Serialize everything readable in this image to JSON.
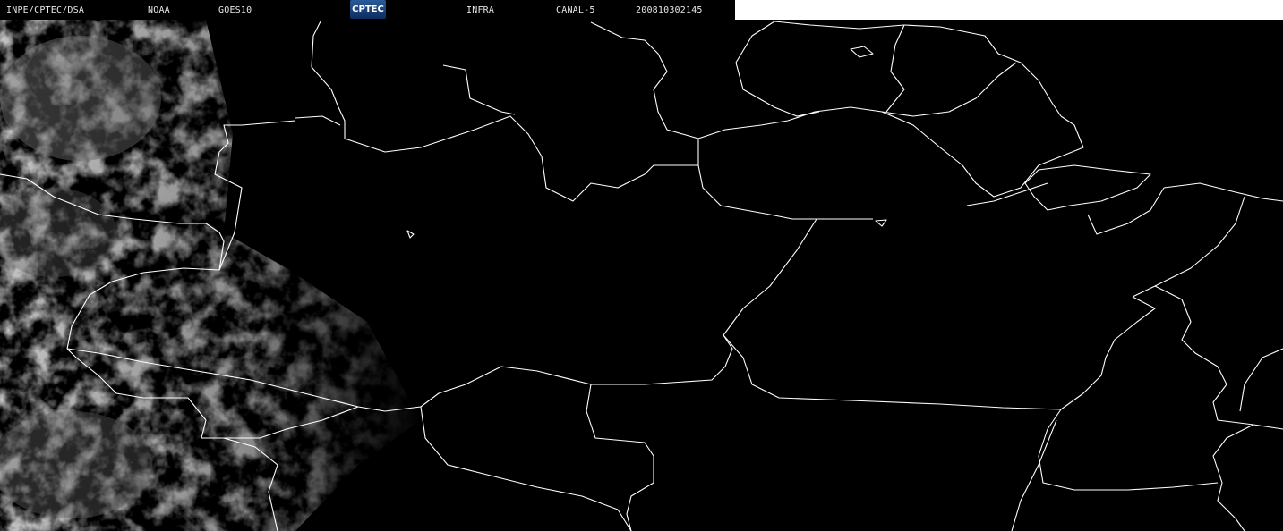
{
  "header": {
    "institution": "INPE/CPTEC/DSA",
    "agency": "NOAA",
    "satellite": "GOES10",
    "logo_text": "CPTEC",
    "band_type": "INFRA",
    "channel": "CANAL-5",
    "timestamp": "200810302145"
  },
  "colors": {
    "background": "#000000",
    "border": "#ffffff",
    "clouds": "#8a8a8a"
  }
}
